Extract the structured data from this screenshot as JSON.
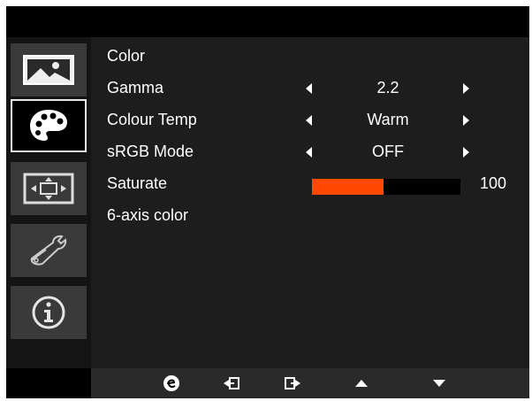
{
  "sidebar": {
    "items": [
      {
        "icon": "picture-icon",
        "active": false
      },
      {
        "icon": "palette-icon",
        "active": true
      },
      {
        "icon": "display-size-icon",
        "active": false
      },
      {
        "icon": "wrench-icon",
        "active": false
      },
      {
        "icon": "info-icon",
        "active": false
      }
    ]
  },
  "menu": {
    "title": "Color",
    "gamma": {
      "label": "Gamma",
      "value": "2.2"
    },
    "colour_temp": {
      "label": "Colour Temp",
      "value": "Warm"
    },
    "srgb_mode": {
      "label": "sRGB Mode",
      "value": "OFF"
    },
    "saturate": {
      "label": "Saturate",
      "value": "100",
      "level_fraction": 0.48
    },
    "six_axis": {
      "label": "6-axis color"
    }
  },
  "bottom_bar": {
    "buttons": [
      "e-key-icon",
      "enter-icon",
      "exit-icon",
      "up-arrow-icon",
      "down-arrow-icon"
    ]
  },
  "colors": {
    "accent": "#ff4800",
    "panel": "#1d1d1d",
    "sidebar_item": "#3a3a3a"
  }
}
